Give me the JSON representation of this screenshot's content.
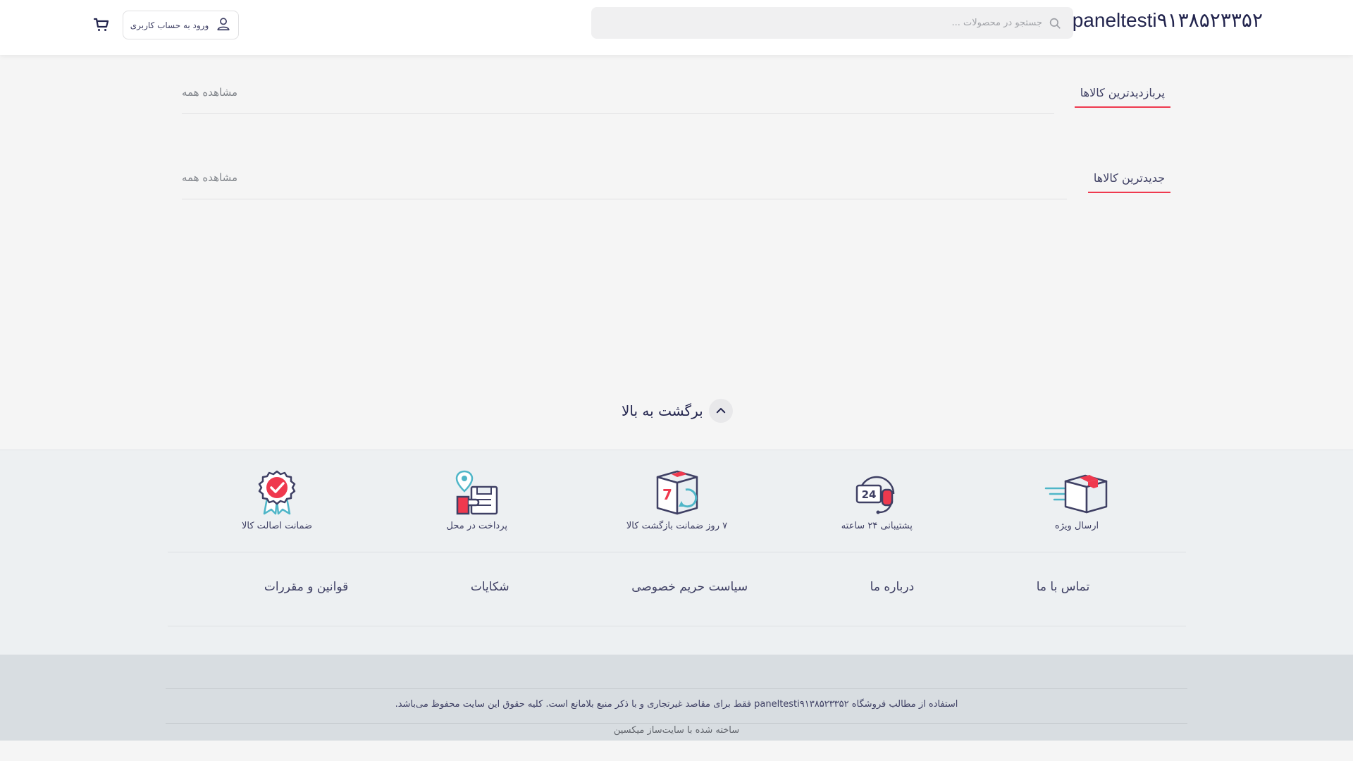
{
  "header": {
    "logo": "paneltesti۹۱۳۸۵۲۳۳۵۲",
    "search_placeholder": "جستجو در محصولات ...",
    "login_label": "ورود به حساب کاربری",
    "icons": [
      "search-icon",
      "user-icon",
      "cart-icon"
    ]
  },
  "sections": [
    {
      "title": "پربازدیدترین کالاها",
      "view_all": "مشاهده همه"
    },
    {
      "title": "جدیدترین کالاها",
      "view_all": "مشاهده همه"
    }
  ],
  "back_to_top": {
    "label": "برگشت به بالا",
    "icon": "chevron-up-icon"
  },
  "features": [
    {
      "label": "ارسال ویژه",
      "icon": "delivery-box-icon"
    },
    {
      "label": "پشتیبانی ۲۴ ساعته",
      "icon": "support-24-icon"
    },
    {
      "label": "۷ روز ضمانت بازگشت کالا",
      "icon": "return-7-days-icon"
    },
    {
      "label": "پرداخت در محل",
      "icon": "pay-on-delivery-icon"
    },
    {
      "label": "ضمانت اصالت کالا",
      "icon": "authenticity-badge-icon"
    }
  ],
  "footer_links": [
    {
      "label": "تماس با ما"
    },
    {
      "label": "درباره ما"
    },
    {
      "label": "سیاست حریم خصوصی"
    },
    {
      "label": "شکایات"
    },
    {
      "label": "قوانین و مقررات"
    }
  ],
  "copyright": "استفاده از مطالب فروشگاه paneltesti۹۱۳۸۵۲۳۳۵۲ فقط برای مقاصد غیرتجاری و با ذکر منبع بلامانع است. کلیه حقوق این سایت محفوظ می‌باشد.",
  "builder": "ساخته شده با سایت‌ساز میکسین",
  "colors": {
    "accent": "#ef394e",
    "text": "#3f4064",
    "icon_teal": "#4fb6c8"
  }
}
